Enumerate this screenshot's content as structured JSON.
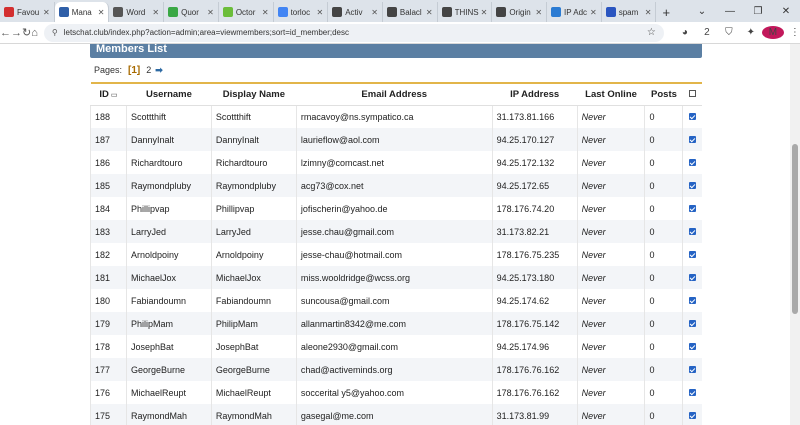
{
  "tabs": [
    {
      "label": "Favou",
      "color": "#d32f2f",
      "active": false
    },
    {
      "label": "Mana",
      "color": "#2f5fa8",
      "active": true
    },
    {
      "label": "Word",
      "color": "#555555",
      "active": false
    },
    {
      "label": "Quor",
      "color": "#3aa845",
      "active": false
    },
    {
      "label": "Octor",
      "color": "#6bbd3a",
      "active": false
    },
    {
      "label": "torloc",
      "color": "#4285f4",
      "active": false
    },
    {
      "label": "Activ",
      "color": "#444444",
      "active": false
    },
    {
      "label": "Balacl",
      "color": "#444444",
      "active": false
    },
    {
      "label": "THINS",
      "color": "#444444",
      "active": false
    },
    {
      "label": "Origin",
      "color": "#444444",
      "active": false
    },
    {
      "label": "IP Adc",
      "color": "#2a7bd3",
      "active": false
    },
    {
      "label": "spam",
      "color": "#2a55c0",
      "active": false
    }
  ],
  "address_bar": {
    "url": "letschat.club/index.php?action=admin;area=viewmembers;sort=id_member;desc"
  },
  "extension_badge": "2",
  "profile_initial": "M",
  "panel": {
    "title": "Members List",
    "pages_label": "Pages:",
    "current_page": "[1]",
    "other_page": "2"
  },
  "columns": {
    "id": "ID",
    "username": "Username",
    "display_name": "Display Name",
    "email": "Email Address",
    "ip": "IP Address",
    "last_online": "Last Online",
    "posts": "Posts"
  },
  "members": [
    {
      "id": "188",
      "username": "Scottthift",
      "display_name": "Scottthift",
      "email": "rmacavoy@ns.sympatico.ca",
      "ip": "31.173.81.166",
      "last_online": "Never",
      "posts": "0"
    },
    {
      "id": "187",
      "username": "DannyInalt",
      "display_name": "DannyInalt",
      "email": "laurieflow@aol.com",
      "ip": "94.25.170.127",
      "last_online": "Never",
      "posts": "0"
    },
    {
      "id": "186",
      "username": "Richardtouro",
      "display_name": "Richardtouro",
      "email": "lzimny@comcast.net",
      "ip": "94.25.172.132",
      "last_online": "Never",
      "posts": "0"
    },
    {
      "id": "185",
      "username": "Raymondpluby",
      "display_name": "Raymondpluby",
      "email": "acg73@cox.net",
      "ip": "94.25.172.65",
      "last_online": "Never",
      "posts": "0"
    },
    {
      "id": "184",
      "username": "Phillipvap",
      "display_name": "Phillipvap",
      "email": "jofischerin@yahoo.de",
      "ip": "178.176.74.20",
      "last_online": "Never",
      "posts": "0"
    },
    {
      "id": "183",
      "username": "LarryJed",
      "display_name": "LarryJed",
      "email": "jesse.chau@gmail.com",
      "ip": "31.173.82.21",
      "last_online": "Never",
      "posts": "0"
    },
    {
      "id": "182",
      "username": "Arnoldpoiny",
      "display_name": "Arnoldpoiny",
      "email": "jesse-chau@hotmail.com",
      "ip": "178.176.75.235",
      "last_online": "Never",
      "posts": "0"
    },
    {
      "id": "181",
      "username": "MichaelJox",
      "display_name": "MichaelJox",
      "email": "miss.wooldridge@wcss.org",
      "ip": "94.25.173.180",
      "last_online": "Never",
      "posts": "0"
    },
    {
      "id": "180",
      "username": "Fabiandoumn",
      "display_name": "Fabiandoumn",
      "email": "suncousa@gmail.com",
      "ip": "94.25.174.62",
      "last_online": "Never",
      "posts": "0"
    },
    {
      "id": "179",
      "username": "PhilipMam",
      "display_name": "PhilipMam",
      "email": "allanmartin8342@me.com",
      "ip": "178.176.75.142",
      "last_online": "Never",
      "posts": "0"
    },
    {
      "id": "178",
      "username": "JosephBat",
      "display_name": "JosephBat",
      "email": "aleone2930@gmail.com",
      "ip": "94.25.174.96",
      "last_online": "Never",
      "posts": "0"
    },
    {
      "id": "177",
      "username": "GeorgeBurne",
      "display_name": "GeorgeBurne",
      "email": "chad@activeminds.org",
      "ip": "178.176.76.162",
      "last_online": "Never",
      "posts": "0"
    },
    {
      "id": "176",
      "username": "MichaelReupt",
      "display_name": "MichaelReupt",
      "email": "soccerital y5@yahoo.com",
      "ip": "178.176.76.162",
      "last_online": "Never",
      "posts": "0"
    },
    {
      "id": "175",
      "username": "RaymondMah",
      "display_name": "RaymondMah",
      "email": "gasegal@me.com",
      "ip": "31.173.81.99",
      "last_online": "Never",
      "posts": "0"
    }
  ]
}
